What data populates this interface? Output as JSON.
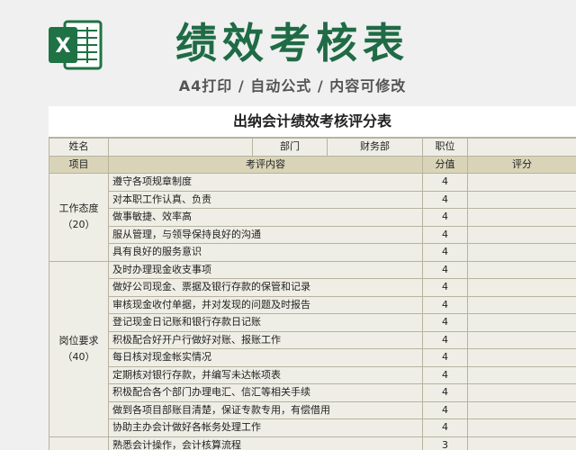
{
  "header": {
    "logo_icon": "excel-icon",
    "logo_letter": "X",
    "title": "绩效考核表",
    "subtitle": "A4打印 / 自动公式 / 内容可修改",
    "title_color": "#1f6b45"
  },
  "sheet": {
    "title": "出纳会计绩效考核评分表",
    "info": {
      "name_label": "姓名",
      "dept_label": "部门",
      "dept_value": "财务部",
      "position_label": "职位"
    },
    "columns": {
      "item": "项目",
      "content": "考评内容",
      "score": "分值",
      "rating": "评分"
    },
    "sections": [
      {
        "name": "工作态度",
        "weight": "（20）",
        "rows": [
          {
            "text": "遵守各项规章制度",
            "score": "4"
          },
          {
            "text": "对本职工作认真、负责",
            "score": "4"
          },
          {
            "text": "做事敏捷、效率高",
            "score": "4"
          },
          {
            "text": "服从管理，与领导保持良好的沟通",
            "score": "4"
          },
          {
            "text": "具有良好的服务意识",
            "score": "4"
          }
        ]
      },
      {
        "name": "岗位要求",
        "weight": "（40）",
        "rows": [
          {
            "text": "及时办理现金收支事项",
            "score": "4"
          },
          {
            "text": "做好公司现金、票据及银行存款的保管和记录",
            "score": "4"
          },
          {
            "text": "审核现金收付单据，并对发现的问题及时报告",
            "score": "4"
          },
          {
            "text": "登记现金日记账和银行存款日记账",
            "score": "4"
          },
          {
            "text": "积极配合好开户行做好对账、报账工作",
            "score": "4"
          },
          {
            "text": "每日核对现金帐实情况",
            "score": "4"
          },
          {
            "text": "定期核对银行存款，并编写未达帐项表",
            "score": "4"
          },
          {
            "text": "积极配合各个部门办理电汇、信汇等相关手续",
            "score": "4"
          },
          {
            "text": "做到各项目部账目清楚，保证专款专用，有偿借用",
            "score": "4"
          },
          {
            "text": "协助主办会计做好各帐务处理工作",
            "score": "4"
          }
        ]
      },
      {
        "name": "",
        "weight": "",
        "rows": [
          {
            "text": "熟悉会计操作，会计核算流程",
            "score": "3"
          }
        ]
      }
    ]
  }
}
